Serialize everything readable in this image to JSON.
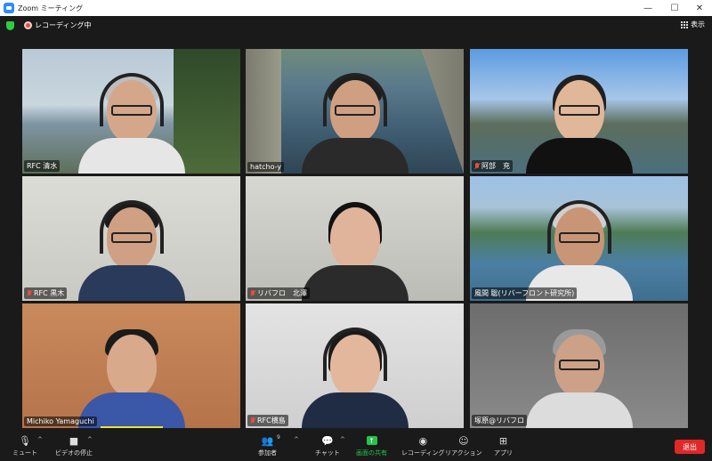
{
  "window": {
    "title": "Zoom ミーティング",
    "controls": [
      "—",
      "☐",
      "✕"
    ]
  },
  "topbar": {
    "recording_label": "レコーディング中",
    "view_label": "表示"
  },
  "participants": [
    {
      "name": "RFC 清水",
      "muted": false
    },
    {
      "name": "hatcho-y",
      "muted": false,
      "active_speaker": true
    },
    {
      "name": "阿部　充",
      "muted": true
    },
    {
      "name": "RFC 黒木",
      "muted": true
    },
    {
      "name": "リバフロ　北澤",
      "muted": true
    },
    {
      "name": "風間 聡(リバーフロント研究所)",
      "muted": false
    },
    {
      "name": "Michiko Yamaguchi",
      "muted": false
    },
    {
      "name": "RFC横島",
      "muted": true
    },
    {
      "name": "塚原@リバフロ",
      "muted": false
    }
  ],
  "toolbar": {
    "mute": "ミュート",
    "stop_video": "ビデオの停止",
    "participants": "参加者",
    "participants_count": "9",
    "chat": "チャット",
    "share_screen": "画面の共有",
    "record": "レコーディング",
    "reactions": "リアクション",
    "apps": "アプリ",
    "leave": "退出"
  }
}
